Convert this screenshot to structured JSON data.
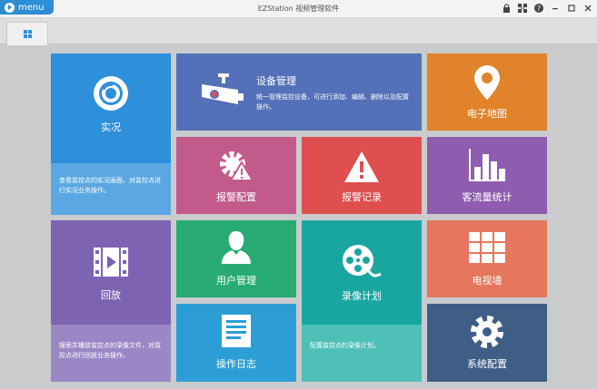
{
  "window": {
    "menu_label": "menu",
    "title": "EZStation 视频管理软件",
    "controls": [
      "lock-icon",
      "network-icon",
      "help-icon",
      "minimize-icon",
      "maximize-icon",
      "close-icon"
    ]
  },
  "tabs": [
    {
      "icon": "grid-icon"
    }
  ],
  "tiles": {
    "live": {
      "title": "实况",
      "desc": "查看监控点的实况画面，对监控点进行实况业务操作。",
      "color": "#2e8fdb",
      "icon": "camera-lens-icon"
    },
    "device": {
      "title": "设备管理",
      "desc": "统一管理监控设备，可进行添加、编辑、删除以及配置操作。",
      "color": "#5470b8",
      "icon": "cctv-camera-icon"
    },
    "map": {
      "title": "电子地图",
      "color": "#e0832a",
      "icon": "location-pin-icon"
    },
    "alarm_config": {
      "title": "报警配置",
      "color": "#c25b8b",
      "icon": "alarm-gear-icon"
    },
    "alarm_record": {
      "title": "报警记录",
      "color": "#df4f50",
      "icon": "warning-icon"
    },
    "traffic": {
      "title": "客流量统计",
      "color": "#8f5cb0",
      "icon": "bar-chart-icon"
    },
    "playback": {
      "title": "回放",
      "desc": "搜索并播放监控点的录像文件，对监控点进行回放业务操作。",
      "color": "#7d63b2",
      "icon": "film-play-icon"
    },
    "user": {
      "title": "用户管理",
      "color": "#27ab73",
      "icon": "user-icon"
    },
    "schedule": {
      "title": "录像计划",
      "desc": "配置监控点的录像计划。",
      "color": "#1aa6a0",
      "icon": "film-reel-icon"
    },
    "tvwall": {
      "title": "电视墙",
      "color": "#e6765d",
      "icon": "video-wall-icon"
    },
    "log": {
      "title": "操作日志",
      "color": "#2d9ed5",
      "icon": "document-icon"
    },
    "system": {
      "title": "系统配置",
      "color": "#3f5e86",
      "icon": "gear-icon"
    }
  }
}
